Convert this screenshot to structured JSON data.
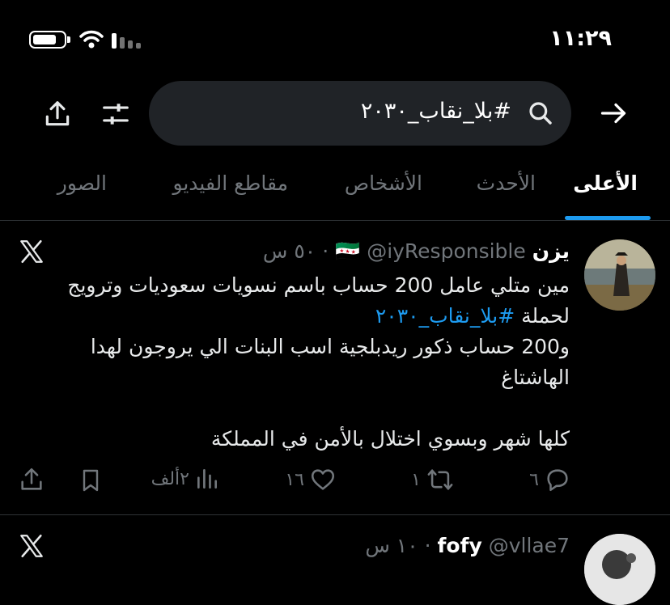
{
  "status_bar": {
    "time": "١١:٢٩"
  },
  "search": {
    "query": "#بلا_نقاب_٢٠٣٠"
  },
  "tabs": [
    {
      "label": "الأعلى",
      "active": true
    },
    {
      "label": "الأحدث",
      "active": false
    },
    {
      "label": "الأشخاص",
      "active": false
    },
    {
      "label": "مقاطع الفيديو",
      "active": false
    },
    {
      "label": "الصور",
      "active": false
    }
  ],
  "tweets": [
    {
      "name": "يزن",
      "flag": "🇸🇾",
      "handle": "@iyResponsible",
      "time": "٥٠ س",
      "lines": [
        "مين متلي عامل 200 حساب باسم نسويات سعوديات وترويج",
        "لحملة",
        "و200 حساب ذكور ريدبلجية اسب البنات الي يروجون لهدا",
        "الهاشتاغ",
        "كلها شهر وبسوي اختلال بالأمن في المملكة"
      ],
      "hashtag": "#بلا_نقاب_٢٠٣٠",
      "replies": "٦",
      "retweets": "١",
      "likes": "١٦",
      "views": "٢ألف"
    },
    {
      "name": "fofy",
      "handle": "@vllae7",
      "time": "١٠ س"
    }
  ],
  "colors": {
    "accent": "#1d9bf0",
    "muted": "#71767b",
    "background": "#000000",
    "search_bg": "#202327"
  }
}
